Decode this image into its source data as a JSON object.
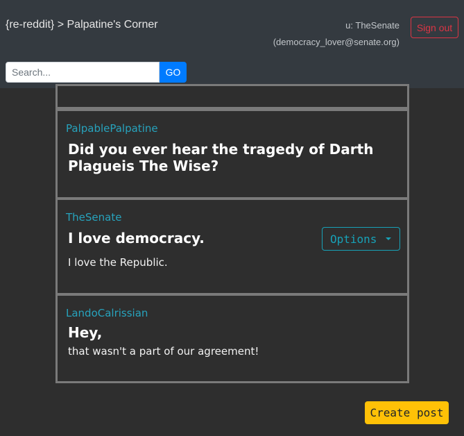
{
  "header": {
    "brand": "{re-reddit} > Palpatine's Corner",
    "user": "u: TheSenate",
    "email": "(democracy_lover@senate.org)",
    "signout_label": "Sign out"
  },
  "search": {
    "placeholder": "Search...",
    "value": "",
    "go_label": "GO"
  },
  "posts": [
    {
      "author": "PalpablePalpatine",
      "title": "Did you ever hear the tragedy of Darth Plagueis The Wise?",
      "body": ""
    },
    {
      "author": "TheSenate",
      "title": "I love democracy.",
      "body": "I love the Republic.",
      "options_label": "Options"
    },
    {
      "author": "LandoCalrissian",
      "title": "Hey,",
      "body": "that wasn't a part of our agreement!"
    }
  ],
  "actions": {
    "create_post_label": "Create post"
  },
  "colors": {
    "background": "#2e2e2e",
    "navbar": "#343a40",
    "author": "#27a3bd",
    "signout": "#dc3545",
    "go": "#007bff",
    "options": "#17a2b8",
    "create": "#ffc107"
  },
  "icons": {
    "options_caret": "caret-down-icon"
  }
}
